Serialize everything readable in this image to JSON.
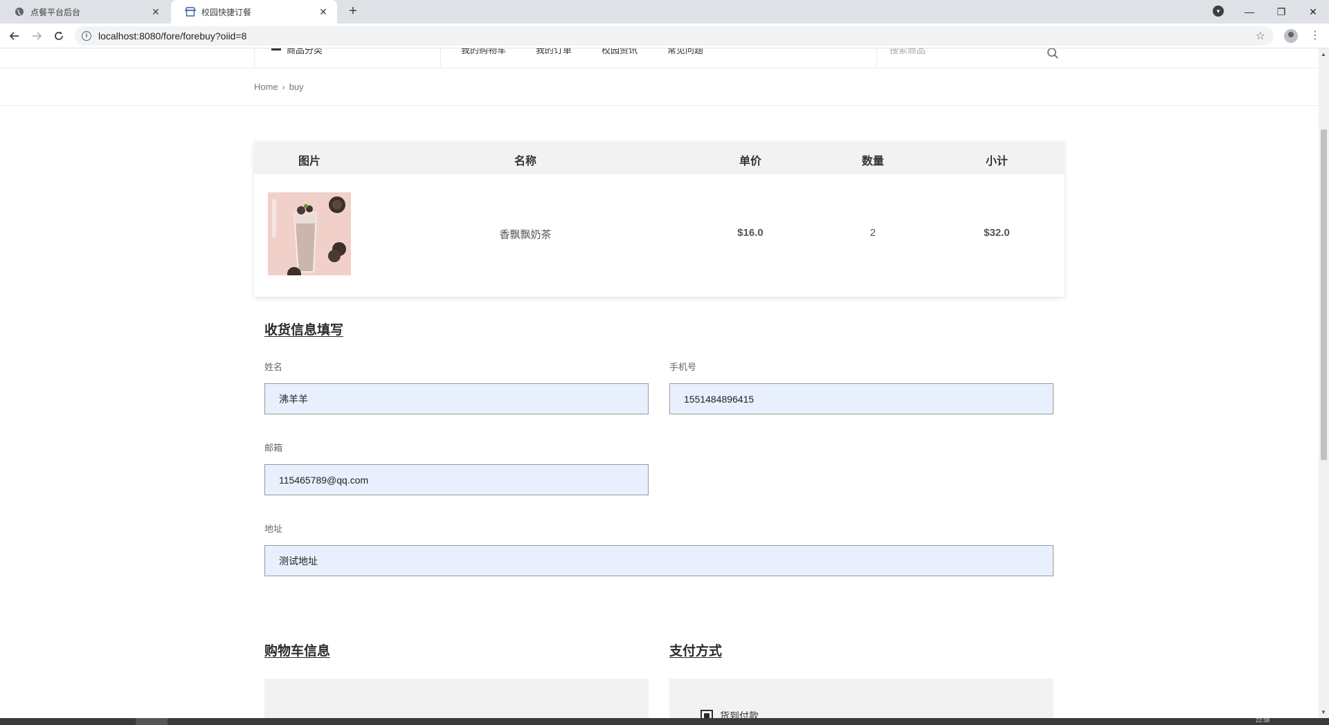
{
  "browser": {
    "tabs": [
      {
        "title": "点餐平台后台",
        "active": false,
        "icon": "globe-icon"
      },
      {
        "title": "校园快捷订餐",
        "active": true,
        "icon": "store-icon"
      }
    ],
    "new_tab": "+",
    "url": "localhost:8080/fore/forebuy?oiid=8",
    "controls": {
      "minimize": "—",
      "restore": "❐",
      "close": "✕"
    }
  },
  "header": {
    "categories_label": "商品分类",
    "nav_links": [
      "我的购物车",
      "我的订单",
      "校园资讯",
      "常见问题"
    ],
    "search_placeholder": "搜索商品"
  },
  "breadcrumb": {
    "home": "Home",
    "separator": "›",
    "current": "buy"
  },
  "order_table": {
    "columns": [
      "图片",
      "名称",
      "单价",
      "数量",
      "小计"
    ],
    "rows": [
      {
        "image_alt": "milk-tea-product-image",
        "name": "香飘飘奶茶",
        "unit_price": "$16.0",
        "quantity": "2",
        "subtotal": "$32.0"
      }
    ]
  },
  "shipping_form": {
    "title": "收货信息填写",
    "name_label": "姓名",
    "name_value": "沸羊羊",
    "phone_label": "手机号",
    "phone_value": "1551484896415",
    "email_label": "邮箱",
    "email_value": "115465789@qq.com",
    "address_label": "地址",
    "address_value": "测试地址"
  },
  "cart_info": {
    "title": "购物车信息"
  },
  "payment": {
    "title": "支付方式",
    "option_label": "货到付款",
    "option_checked": true
  },
  "taskbar": {
    "clock": "22:38"
  },
  "colors": {
    "input_bg": "#e8f0fe",
    "table_header_bg": "#f2f2f2",
    "title_text": "#2a2a2a"
  }
}
